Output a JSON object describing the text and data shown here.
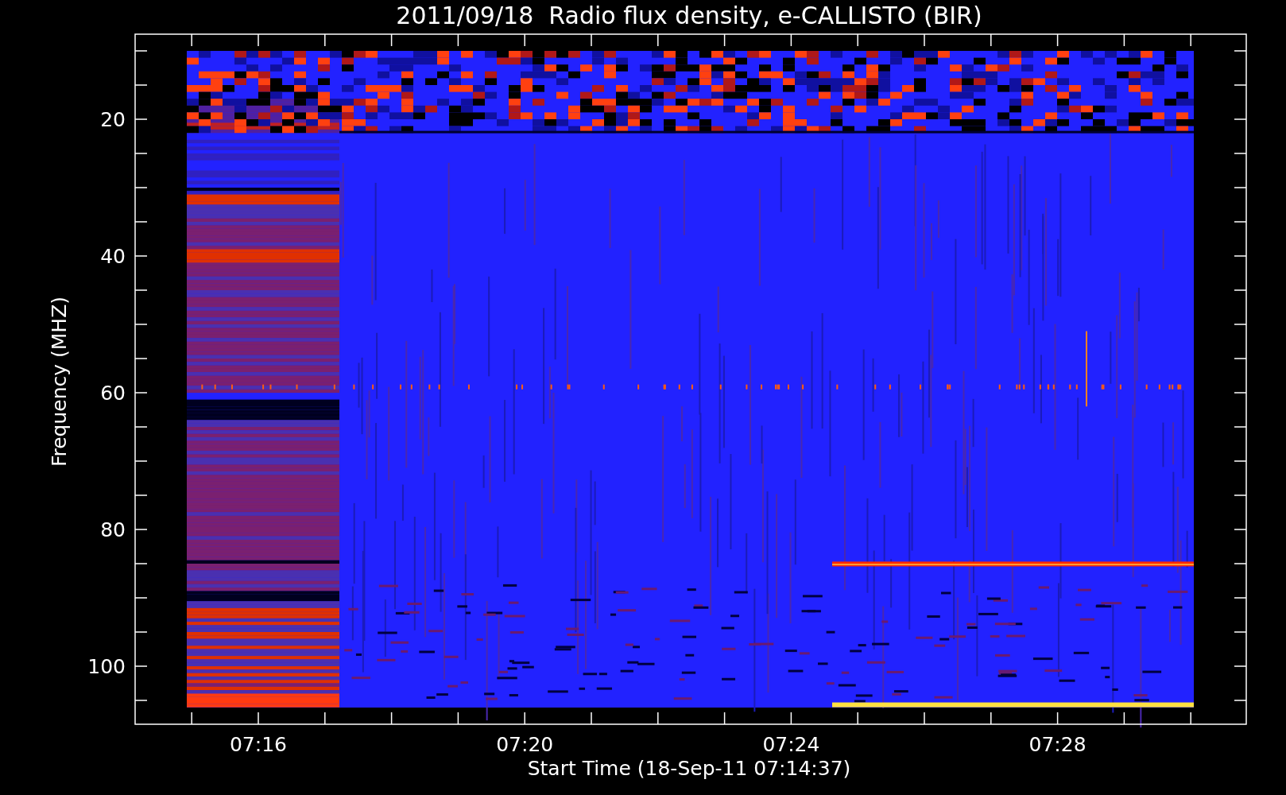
{
  "plot": {
    "title": "2011/09/18  Radio flux density, e-CALLISTO (BIR)",
    "ylabel": "Frequency (MHZ)",
    "xlabel": "Start Time (18-Sep-11 07:14:37)",
    "yticks": [
      "20",
      "40",
      "60",
      "80",
      "100"
    ],
    "xticks": [
      "07:16",
      "07:20",
      "07:24",
      "07:28"
    ]
  }
}
